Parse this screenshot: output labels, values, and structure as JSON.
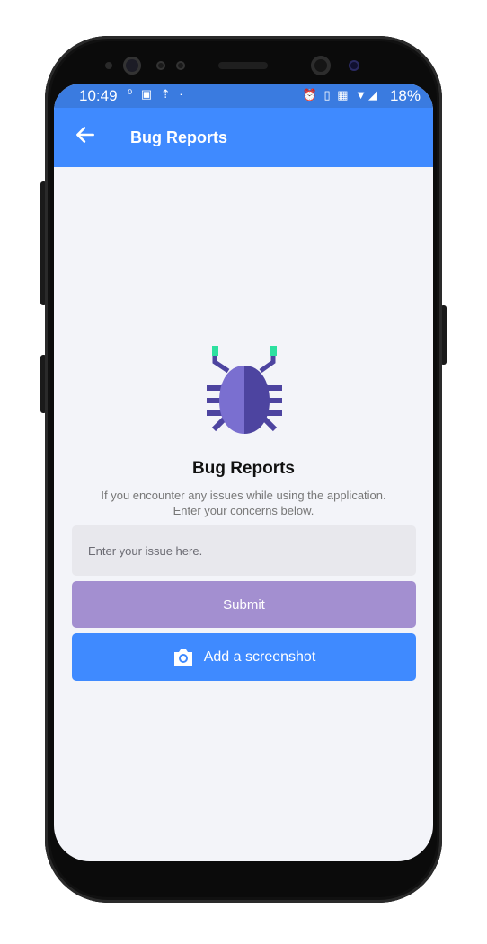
{
  "status_bar": {
    "time": "10:49",
    "left_icons": "⁰ ▣ ⇡ ·",
    "right_icons": "⏰ ▯ ▦ ▼◢",
    "battery": "18%"
  },
  "app_bar": {
    "title": "Bug Reports",
    "back_icon": "arrow-left-icon"
  },
  "content": {
    "title": "Bug Reports",
    "description_line1": "If you encounter any issues while using the application.",
    "description_line2": "Enter your concerns below.",
    "issue_placeholder": "Enter your issue here.",
    "submit_label": "Submit",
    "screenshot_label": "Add a screenshot"
  },
  "colors": {
    "app_bar": "#3f8aff",
    "status_bar": "#3a7be0",
    "submit_button": "#a38fd0",
    "screenshot_button": "#3f8aff",
    "background": "#f3f4f9",
    "bug_body_light": "#7a6fd0",
    "bug_body_dark": "#4d44a0",
    "bug_antenna_tip": "#2de0a0"
  }
}
